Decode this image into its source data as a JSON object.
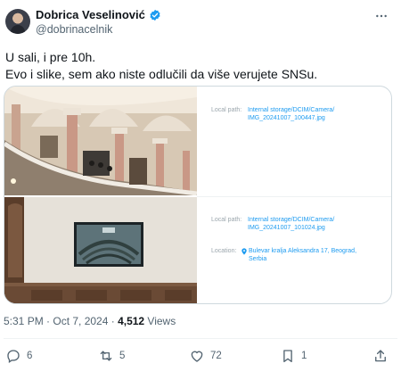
{
  "author": {
    "name": "Dobrica Veselinović",
    "handle": "@dobrinacelnik"
  },
  "tweet": {
    "line1": "U sali, i pre 10h.",
    "line2": "Evo i slike, sem ako niste odlučili da više verujete SNSu."
  },
  "card": {
    "photo1": {
      "local_path_label": "Local path:",
      "local_path_value": "Internal storage/DCIM/Camera/ IMG_20241007_100447.jpg"
    },
    "photo2": {
      "local_path_label": "Local path:",
      "local_path_value": "Internal storage/DCIM/Camera/ IMG_20241007_101024.jpg",
      "location_label": "Location:",
      "location_value": "Bulevar kralja Aleksandra 17, Beograd, Serbia"
    }
  },
  "meta": {
    "time_date": "5:31 PM · Oct 7, 2024 · ",
    "views_count": "4,512",
    "views_label": " Views"
  },
  "actions": {
    "replies": "6",
    "reposts": "5",
    "likes": "72",
    "bookmarks": "1"
  },
  "colors": {
    "accent": "#1d9bf0",
    "muted": "#536471",
    "border": "#cfd9de"
  },
  "icons": [
    "verified-icon",
    "more-icon",
    "reply-icon",
    "repost-icon",
    "like-icon",
    "bookmark-icon",
    "share-icon",
    "location-pin-icon"
  ]
}
